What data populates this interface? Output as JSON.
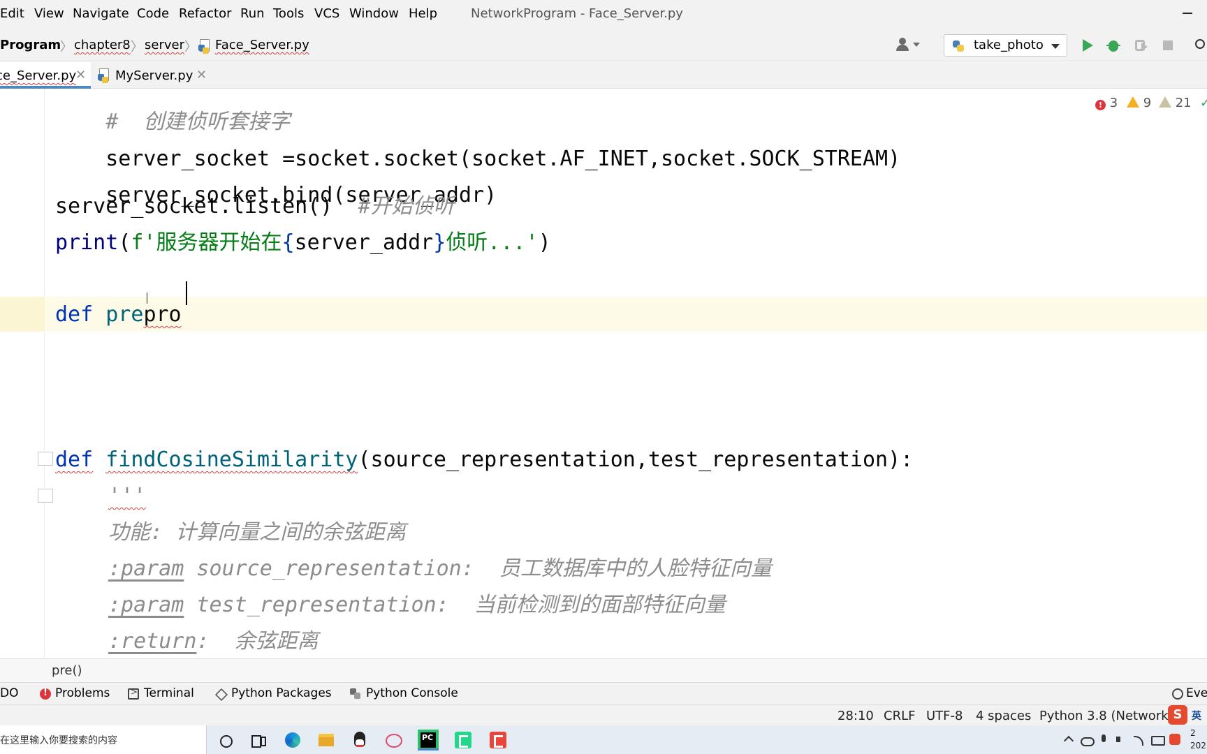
{
  "menu": {
    "items": [
      "Edit",
      "View",
      "Navigate",
      "Code",
      "Refactor",
      "Run",
      "Tools",
      "VCS",
      "Window",
      "Help"
    ],
    "window_title": "NetworkProgram - Face_Server.py"
  },
  "navbar": {
    "breadcrumbs": [
      "Program",
      "chapter8",
      "server",
      "Face_Server.py"
    ],
    "run_config": "take_photo"
  },
  "tabs": [
    {
      "label": "ce_Server.py",
      "active": true
    },
    {
      "label": "MyServer.py",
      "active": false
    }
  ],
  "inspections": {
    "errors": "3",
    "warnings": "9",
    "weak_warnings": "21"
  },
  "editor": {
    "lines": {
      "comment": "#  创建侦听套接字",
      "socket_create": "server_socket =socket.socket(socket.AF_INET,socket.SOCK_STREAM)",
      "bind": "server_socket.bind(server_addr)",
      "listen_code": "server_socket.listen()  ",
      "listen_comment": "#开始侦听",
      "print_fn": "print",
      "print_open": "(",
      "print_f": "f'",
      "print_str1": "服务器开始在",
      "print_brace_open": "{",
      "print_var": "server_addr",
      "print_brace_close": "}",
      "print_str2": "侦听...'",
      "print_close": ")",
      "def_kw": "def",
      "def_typed_pre": "pre",
      "def_typed_pro": "pro",
      "cos_def_kw": "def",
      "cos_name": "findCosineSimilarity",
      "cos_params": "(source_representation,test_representation):",
      "doc_quote": "'''",
      "doc_func": "功能: 计算向量之间的余弦距离",
      "doc_param_tag_1": ":param",
      "doc_param_1": " source_representation:  员工数据库中的人脸特征向量",
      "doc_param_tag_2": ":param",
      "doc_param_2": " test_representation:  当前检测到的面部特征向量",
      "doc_return_tag": ":return",
      "doc_return": ":  余弦距离"
    }
  },
  "code_breadcrumb": "pre()",
  "tool_windows": [
    "DO",
    "Problems",
    "Terminal",
    "Python Packages",
    "Python Console",
    "Eve"
  ],
  "status": {
    "position": "28:10",
    "line_sep": "CRLF",
    "encoding": "UTF-8",
    "indent": "4 spaces",
    "interpreter": "Python 3.8 (NetworkP",
    "ime_lang": "英"
  },
  "taskbar": {
    "search_placeholder": "在这里输入你要搜索的内容",
    "clock_line1": "2",
    "clock_line2": "202"
  },
  "colors": {
    "keyword": "#0033b3",
    "function_name": "#00627a",
    "string": "#067d17",
    "comment": "#8c8c8c",
    "active_tab_underline": "#4a88c7",
    "run_green": "#3aa657",
    "error_red": "#d9363e",
    "warning_yellow": "#f2b124"
  }
}
